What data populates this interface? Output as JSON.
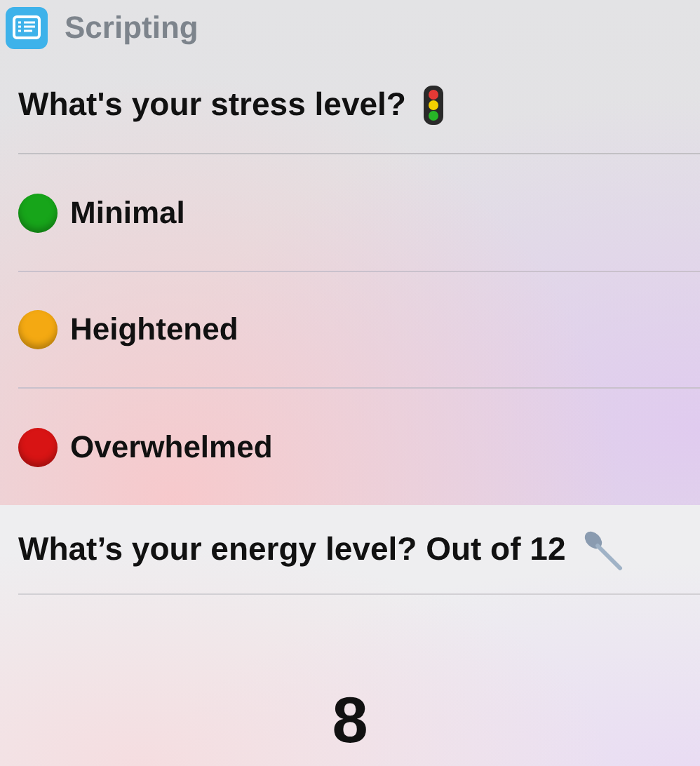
{
  "app": {
    "name": "Scripting"
  },
  "stress": {
    "question": "What's your stress level?",
    "options": [
      {
        "label": "Minimal",
        "color": "#17a51a"
      },
      {
        "label": "Heightened",
        "color": "#f4a912"
      },
      {
        "label": "Overwhelmed",
        "color": "#d81414"
      }
    ]
  },
  "energy": {
    "question": "What’s your energy level? Out of 12",
    "value": "8"
  }
}
